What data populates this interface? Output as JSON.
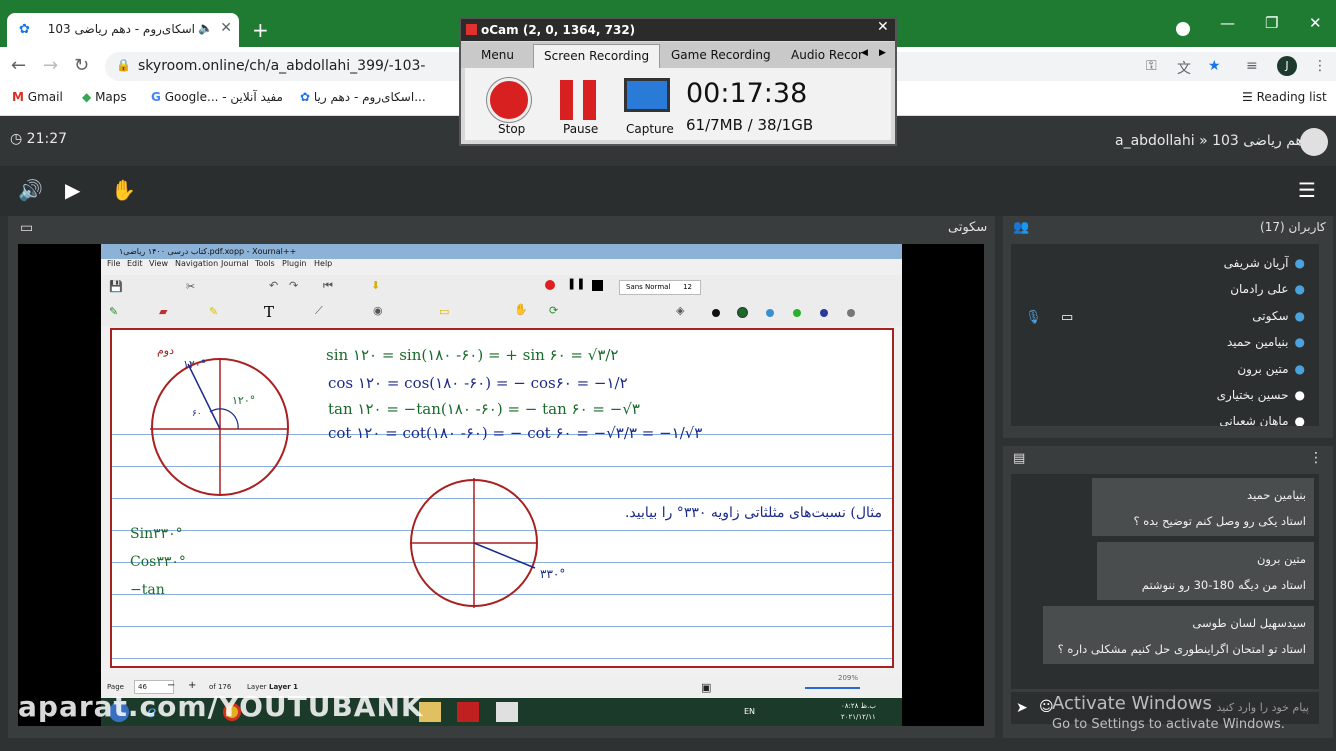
{
  "browser": {
    "tab_title": "اسکای‌روم - دهم ریاضی 103",
    "url": "skyroom.online/ch/a_abdollahi_399/-103-",
    "profile_initial": "J",
    "bookmarks": [
      "Gmail",
      "Maps",
      "Google... - مفید آنلاین",
      "اسکای‌روم - دهم ریا..."
    ],
    "reading_list": "Reading list"
  },
  "skyroom": {
    "clock": "21:27",
    "room_title": "a_abdollahi » دهم ریاضی 103",
    "main_panel_label": "سکوتی",
    "users_title": "کاربران (17)",
    "users": [
      "آریان شریفی",
      "علی رادمان",
      "سکوتی",
      "بنیامین حمید",
      "متین برون",
      "حسین بختیاری",
      "ماهان شعبانی"
    ],
    "chat": [
      {
        "name": "بنیامین حمید",
        "text": "استاد یکی رو وصل کنم توضیح بده ؟"
      },
      {
        "name": "متین برون",
        "text": "استاد من دیگه 180-30 رو ننوشتم"
      },
      {
        "name": "سیدسهیل لسان طوسی",
        "text": "استاد تو امتحان اگراینطوری حل کنیم مشکلی داره ؟"
      }
    ],
    "chat_placeholder": "پیام خود را وارد کنید"
  },
  "ocam": {
    "title": "oCam (2, 0, 1364, 732)",
    "tabs": [
      "Menu",
      "Screen Recording",
      "Game Recording",
      "Audio Recor"
    ],
    "stop": "Stop",
    "pause": "Pause",
    "capture": "Capture",
    "timer": "00:17:38",
    "size": "61/7MB / 38/1GB"
  },
  "xournal": {
    "title": "کتاب درسی ۱۴۰۰ ریاضی۱.pdf.xopp - Xournal++",
    "menu": [
      "File",
      "Edit",
      "View",
      "Navigation",
      "Journal",
      "Tools",
      "Plugin",
      "Help"
    ],
    "font": "Sans Normal",
    "font_size": "12",
    "page_label": "Page",
    "page_num": "46",
    "of_pages": "of 176",
    "layer_label": "Layer",
    "layer_value": "Layer 1",
    "zoom": "209%",
    "lang": "EN",
    "date": "۲۰۲۱/۱۲/۱۱",
    "time": "۰۸:۲۸ ب.ظ",
    "handwriting": {
      "l1": "sin ۱۲۰ = sin(۱۸۰ -۶۰) = + sin ۶۰ = √۳/۲",
      "l2": "cos ۱۲۰ = cos(۱۸۰ -۶۰) = − cos۶۰ = −۱/۲",
      "l3": "tan ۱۲۰ = −tan(۱۸۰ -۶۰) = − tan ۶۰ = −√۳",
      "l4": "cot ۱۲۰ = cot(۱۸۰ -۶۰) = − cot ۶۰ = −√۳/۳ = −۱/√۳",
      "angle120": "۱۲۰°",
      "angle60": "۶۰",
      "dovom": "دوم",
      "mesal": "مثال) نسبت‌های مثلثاتی زاویه ۳۳۰° را بیابید.",
      "angle330": "۳۳۰°",
      "sin330": "Sin۳۳۰°",
      "cos330": "Cos۳۳۰°",
      "tan": "−tan"
    }
  },
  "watermark": "aparat.com/YOUTUBANK",
  "activate": {
    "line1": "Activate Windows",
    "line2": "Go to Settings to activate Windows."
  }
}
